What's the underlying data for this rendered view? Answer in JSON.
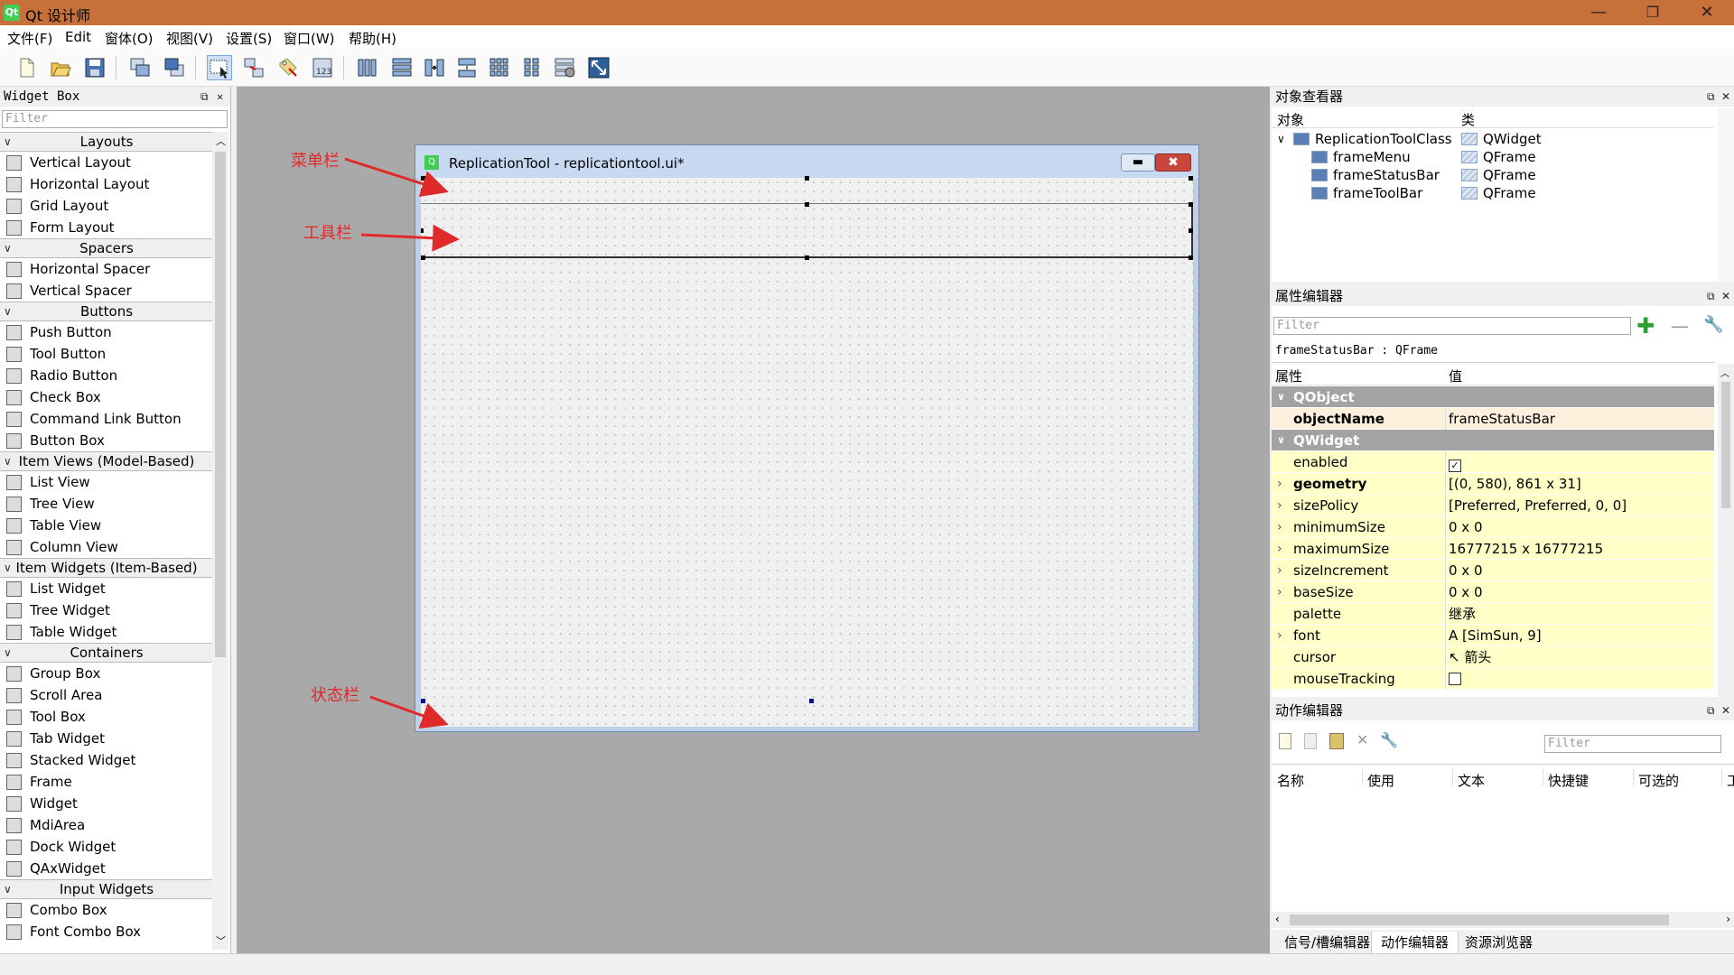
{
  "app": {
    "title": "Qt 设计师",
    "icon": "qt-logo-icon"
  },
  "window_buttons": {
    "minimize": "—",
    "maximize": "❐",
    "close": "✕"
  },
  "menu": [
    "文件(F)",
    "Edit",
    "窗体(O)",
    "视图(V)",
    "设置(S)",
    "窗口(W)",
    "帮助(H)"
  ],
  "widget_box": {
    "title": "Widget Box",
    "filter_placeholder": "Filter",
    "categories": [
      {
        "name": "Layouts",
        "items": [
          "Vertical Layout",
          "Horizontal Layout",
          "Grid Layout",
          "Form Layout"
        ]
      },
      {
        "name": "Spacers",
        "items": [
          "Horizontal Spacer",
          "Vertical Spacer"
        ]
      },
      {
        "name": "Buttons",
        "items": [
          "Push Button",
          "Tool Button",
          "Radio Button",
          "Check Box",
          "Command Link Button",
          "Button Box"
        ]
      },
      {
        "name": "Item Views (Model-Based)",
        "items": [
          "List View",
          "Tree View",
          "Table View",
          "Column View"
        ]
      },
      {
        "name": "Item Widgets (Item-Based)",
        "items": [
          "List Widget",
          "Tree Widget",
          "Table Widget"
        ]
      },
      {
        "name": "Containers",
        "items": [
          "Group Box",
          "Scroll Area",
          "Tool Box",
          "Tab Widget",
          "Stacked Widget",
          "Frame",
          "Widget",
          "MdiArea",
          "Dock Widget",
          "QAxWidget"
        ]
      },
      {
        "name": "Input Widgets",
        "items": [
          "Combo Box",
          "Font Combo Box"
        ]
      }
    ]
  },
  "form": {
    "title": "ReplicationTool - replicationtool.ui*",
    "minimize": "▬",
    "close": "✖"
  },
  "annotations": {
    "menu": "菜单栏",
    "toolbar": "工具栏",
    "status": "状态栏"
  },
  "object_inspector": {
    "title": "对象查看器",
    "col_object": "对象",
    "col_class": "类",
    "rows": [
      {
        "name": "ReplicationToolClass",
        "class": "QWidget"
      },
      {
        "name": "frameMenu",
        "class": "QFrame"
      },
      {
        "name": "frameStatusBar",
        "class": "QFrame"
      },
      {
        "name": "frameToolBar",
        "class": "QFrame"
      }
    ]
  },
  "property_editor": {
    "title": "属性编辑器",
    "filter_placeholder": "Filter",
    "context": "frameStatusBar : QFrame",
    "col_property": "属性",
    "col_value": "值",
    "rows": [
      {
        "name": "QObject",
        "value": "",
        "group": true
      },
      {
        "name": "objectName",
        "value": "frameStatusBar"
      },
      {
        "name": "QWidget",
        "value": "",
        "group": true
      },
      {
        "name": "enabled",
        "value": "✓"
      },
      {
        "name": "geometry",
        "value": "[(0, 580), 861 x 31]"
      },
      {
        "name": "sizePolicy",
        "value": "[Preferred, Preferred, 0, 0]"
      },
      {
        "name": "minimumSize",
        "value": "0 x 0"
      },
      {
        "name": "maximumSize",
        "value": "16777215 x 16777215"
      },
      {
        "name": "sizeIncrement",
        "value": "0 x 0"
      },
      {
        "name": "baseSize",
        "value": "0 x 0"
      },
      {
        "name": "palette",
        "value": "继承"
      },
      {
        "name": "font",
        "value": "A  [SimSun, 9]"
      },
      {
        "name": "cursor",
        "value": "↖  箭头"
      },
      {
        "name": "mouseTracking",
        "value": ""
      }
    ]
  },
  "action_editor": {
    "title": "动作编辑器",
    "filter_placeholder": "Filter",
    "columns": [
      "名称",
      "使用",
      "文本",
      "快捷键",
      "可选的",
      "工"
    ]
  },
  "bottom_tabs": [
    "信号/槽编辑器",
    "动作编辑器",
    "资源浏览器"
  ],
  "colors": {
    "titlebar": "#c8703a",
    "workspace": "#a9a9a9",
    "annotation": "#e02a2a",
    "property_highlight": "#ffffc8",
    "object_highlight": "#fdf0dc"
  }
}
